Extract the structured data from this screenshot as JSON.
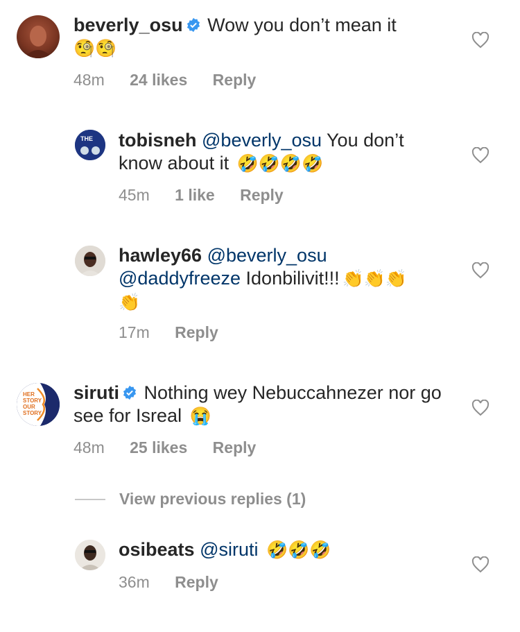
{
  "comments": [
    {
      "username": "beverly_osu",
      "verified": true,
      "text": "Wow you don’t mean it",
      "emojis": "🧐🧐",
      "time": "48m",
      "likes": "24 likes",
      "reply": "Reply"
    },
    {
      "username": "tobisneh",
      "mention": "@beverly_osu",
      "text": "You don’t know about it",
      "emojis": "🤣🤣🤣🤣",
      "time": "45m",
      "likes": "1 like",
      "reply": "Reply"
    },
    {
      "username": "hawley66",
      "mention": "@beverly_osu",
      "mention2": "@daddyfreeze",
      "text": "Idonbilivit!!!",
      "emojis": "👏👏👏",
      "emojis2": "👏",
      "time": "17m",
      "reply": "Reply"
    },
    {
      "username": "siruti",
      "verified": true,
      "text": "Nothing wey Nebuccahnezer nor go see for Isreal",
      "emojis": "😭",
      "time": "48m",
      "likes": "25 likes",
      "reply": "Reply",
      "avatar_text": "HER STORY OUR STORY"
    },
    {
      "username": "osibeats",
      "mention": "@siruti",
      "emojis": "🤣🤣🤣",
      "time": "36m",
      "reply": "Reply"
    }
  ],
  "view_previous": "View previous replies (1)",
  "colors": {
    "text": "#262626",
    "muted": "#8e8e8e",
    "mention": "#003569",
    "verified": "#3897f0",
    "heart_stroke": "#8e8e8e"
  },
  "icons": {
    "like": "heart-outline-icon",
    "verified": "verified-badge-icon"
  }
}
